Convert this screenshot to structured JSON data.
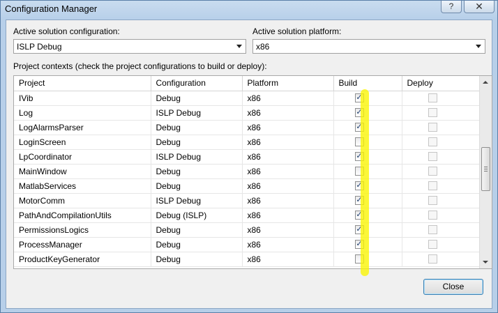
{
  "window": {
    "title": "Configuration Manager",
    "help_glyph": "?",
    "close_glyph": "✕"
  },
  "solution_config": {
    "label": "Active solution configuration:",
    "value": "ISLP Debug"
  },
  "solution_platform": {
    "label": "Active solution platform:",
    "value": "x86"
  },
  "contexts_label": "Project contexts (check the project configurations to build or deploy):",
  "columns": [
    "Project",
    "Configuration",
    "Platform",
    "Build",
    "Deploy"
  ],
  "rows": [
    {
      "project": "IVib",
      "config": "Debug",
      "platform": "x86",
      "build": true,
      "deploy": false
    },
    {
      "project": "Log",
      "config": "ISLP Debug",
      "platform": "x86",
      "build": true,
      "deploy": false
    },
    {
      "project": "LogAlarmsParser",
      "config": "Debug",
      "platform": "x86",
      "build": true,
      "deploy": false
    },
    {
      "project": "LoginScreen",
      "config": "Debug",
      "platform": "x86",
      "build": false,
      "deploy": false
    },
    {
      "project": "LpCoordinator",
      "config": "ISLP Debug",
      "platform": "x86",
      "build": true,
      "deploy": false
    },
    {
      "project": "MainWindow",
      "config": "Debug",
      "platform": "x86",
      "build": false,
      "deploy": false
    },
    {
      "project": "MatlabServices",
      "config": "Debug",
      "platform": "x86",
      "build": true,
      "deploy": false
    },
    {
      "project": "MotorComm",
      "config": "ISLP Debug",
      "platform": "x86",
      "build": true,
      "deploy": false
    },
    {
      "project": "PathAndCompilationUtils",
      "config": "Debug (ISLP)",
      "platform": "x86",
      "build": true,
      "deploy": false
    },
    {
      "project": "PermissionsLogics",
      "config": "Debug",
      "platform": "x86",
      "build": true,
      "deploy": false
    },
    {
      "project": "ProcessManager",
      "config": "Debug",
      "platform": "x86",
      "build": true,
      "deploy": false
    },
    {
      "project": "ProductKeyGenerator",
      "config": "Debug",
      "platform": "x86",
      "build": false,
      "deploy": false
    }
  ],
  "buttons": {
    "close": "Close"
  },
  "colors": {
    "highlighter": "#faf500",
    "title_bar": "#b7cfe9"
  }
}
